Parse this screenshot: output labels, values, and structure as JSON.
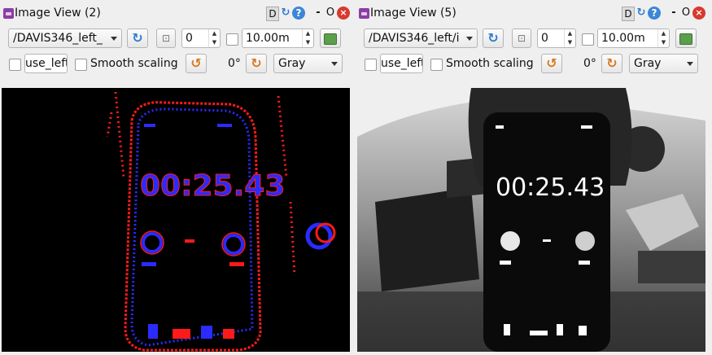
{
  "left_panel": {
    "title": "Image View (2)",
    "topic": "/DAVIS346_left_",
    "index_value": "0",
    "distance_value": "10.00m",
    "mouse_field": "use_left",
    "smooth_label": "Smooth scaling",
    "rotation_value": "0°",
    "color_mode": "Gray",
    "timer_text": "00:25.43",
    "colors": {
      "positive_events": "#ff1a1a",
      "negative_events": "#2b2bff",
      "background": "#000000"
    }
  },
  "right_panel": {
    "title": "Image View (5)",
    "topic": "/DAVIS346_left/i",
    "index_value": "0",
    "distance_value": "10.00m",
    "mouse_field": "use_left",
    "smooth_label": "Smooth scaling",
    "rotation_value": "0°",
    "color_mode": "Gray",
    "timer_text": "00:25.43"
  },
  "title_icons": {
    "d_label": "D",
    "minimize": "-",
    "o_label": "O",
    "close": "×"
  }
}
